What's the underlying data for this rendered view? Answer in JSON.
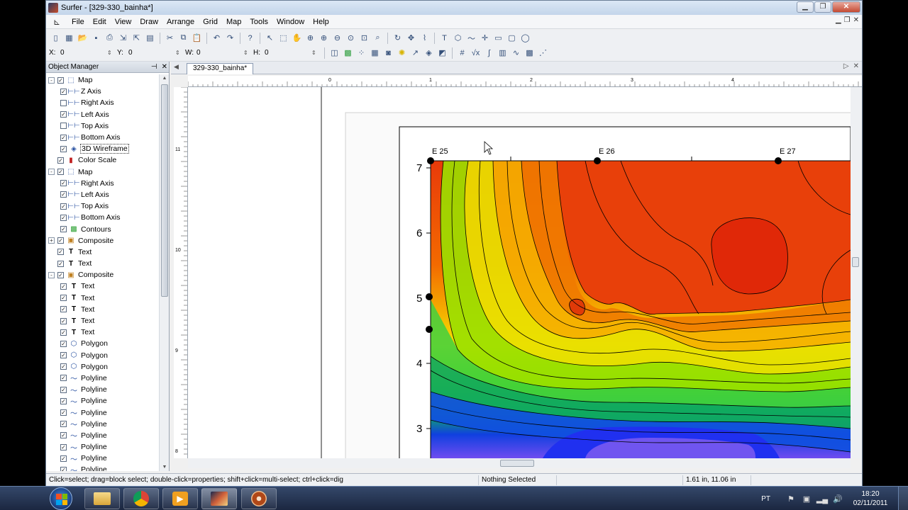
{
  "window": {
    "title": "Surfer - [329-330_bainha*]"
  },
  "menu": [
    "File",
    "Edit",
    "View",
    "Draw",
    "Arrange",
    "Grid",
    "Map",
    "Tools",
    "Window",
    "Help"
  ],
  "toolbar2": {
    "x_label": "X:",
    "x_value": "0",
    "y_label": "Y:",
    "y_value": "0",
    "w_label": "W:",
    "w_value": "0",
    "h_label": "H:",
    "h_value": "0"
  },
  "object_manager": {
    "title": "Object Manager",
    "items": [
      {
        "label": "Map",
        "indent": 0,
        "checked": true,
        "expander": "-",
        "icon": "map-frame-icon",
        "glyph": "⬚"
      },
      {
        "label": "Z Axis",
        "indent": 1,
        "checked": true,
        "icon": "axis-icon",
        "glyph": "⊢⊢"
      },
      {
        "label": "Right Axis",
        "indent": 1,
        "checked": false,
        "icon": "axis-icon",
        "glyph": "⊢⊢"
      },
      {
        "label": "Left Axis",
        "indent": 1,
        "checked": true,
        "icon": "axis-icon",
        "glyph": "⊢⊢"
      },
      {
        "label": "Top Axis",
        "indent": 1,
        "checked": false,
        "icon": "axis-icon",
        "glyph": "⊢⊢"
      },
      {
        "label": "Bottom Axis",
        "indent": 1,
        "checked": true,
        "icon": "axis-icon",
        "glyph": "⊢⊢"
      },
      {
        "label": "3D Wireframe",
        "indent": 1,
        "checked": true,
        "icon": "wireframe-icon",
        "glyph": "◈",
        "selected": true
      },
      {
        "label": "Color Scale",
        "indent": 0,
        "checked": true,
        "icon": "color-scale-icon",
        "glyph": "▮"
      },
      {
        "label": "Map",
        "indent": 0,
        "checked": true,
        "expander": "-",
        "icon": "map-frame-icon",
        "glyph": "⬚"
      },
      {
        "label": "Right Axis",
        "indent": 1,
        "checked": true,
        "icon": "axis-icon",
        "glyph": "⊢⊢"
      },
      {
        "label": "Left Axis",
        "indent": 1,
        "checked": true,
        "icon": "axis-icon",
        "glyph": "⊢⊢"
      },
      {
        "label": "Top Axis",
        "indent": 1,
        "checked": true,
        "icon": "axis-icon",
        "glyph": "⊢⊢"
      },
      {
        "label": "Bottom Axis",
        "indent": 1,
        "checked": true,
        "icon": "axis-icon",
        "glyph": "⊢⊢"
      },
      {
        "label": "Contours",
        "indent": 1,
        "checked": true,
        "icon": "contours-icon",
        "glyph": "▩"
      },
      {
        "label": "Composite",
        "indent": 0,
        "checked": true,
        "expander": "+",
        "icon": "composite-icon",
        "glyph": "▣"
      },
      {
        "label": "Text",
        "indent": 0,
        "checked": true,
        "icon": "text-icon",
        "glyph": "T"
      },
      {
        "label": "Text",
        "indent": 0,
        "checked": true,
        "icon": "text-icon",
        "glyph": "T"
      },
      {
        "label": "Composite",
        "indent": 0,
        "checked": true,
        "expander": "-",
        "icon": "composite-icon",
        "glyph": "▣"
      },
      {
        "label": "Text",
        "indent": 1,
        "checked": true,
        "icon": "text-icon",
        "glyph": "T"
      },
      {
        "label": "Text",
        "indent": 1,
        "checked": true,
        "icon": "text-icon",
        "glyph": "T"
      },
      {
        "label": "Text",
        "indent": 1,
        "checked": true,
        "icon": "text-icon",
        "glyph": "T"
      },
      {
        "label": "Text",
        "indent": 1,
        "checked": true,
        "icon": "text-icon",
        "glyph": "T"
      },
      {
        "label": "Text",
        "indent": 1,
        "checked": true,
        "icon": "text-icon",
        "glyph": "T"
      },
      {
        "label": "Polygon",
        "indent": 1,
        "checked": true,
        "icon": "polygon-icon",
        "glyph": "⬡"
      },
      {
        "label": "Polygon",
        "indent": 1,
        "checked": true,
        "icon": "polygon-icon",
        "glyph": "⬡"
      },
      {
        "label": "Polygon",
        "indent": 1,
        "checked": true,
        "icon": "polygon-icon",
        "glyph": "⬡"
      },
      {
        "label": "Polyline",
        "indent": 1,
        "checked": true,
        "icon": "polyline-icon",
        "glyph": "〜"
      },
      {
        "label": "Polyline",
        "indent": 1,
        "checked": true,
        "icon": "polyline-icon",
        "glyph": "〜"
      },
      {
        "label": "Polyline",
        "indent": 1,
        "checked": true,
        "icon": "polyline-icon",
        "glyph": "〜"
      },
      {
        "label": "Polyline",
        "indent": 1,
        "checked": true,
        "icon": "polyline-icon",
        "glyph": "〜"
      },
      {
        "label": "Polyline",
        "indent": 1,
        "checked": true,
        "icon": "polyline-icon",
        "glyph": "〜"
      },
      {
        "label": "Polyline",
        "indent": 1,
        "checked": true,
        "icon": "polyline-icon",
        "glyph": "〜"
      },
      {
        "label": "Polyline",
        "indent": 1,
        "checked": true,
        "icon": "polyline-icon",
        "glyph": "〜"
      },
      {
        "label": "Polyline",
        "indent": 1,
        "checked": true,
        "icon": "polyline-icon",
        "glyph": "〜"
      },
      {
        "label": "Polyline",
        "indent": 1,
        "checked": true,
        "icon": "polyline-icon",
        "glyph": "〜"
      }
    ]
  },
  "document": {
    "tab": "329-330_bainha*",
    "ruler_h_labels": [
      "0",
      "1",
      "2",
      "3",
      "4"
    ],
    "ruler_v_labels": [
      "11",
      "10",
      "9",
      "8"
    ],
    "map": {
      "top_labels": [
        "E 25",
        "E 26",
        "E 27"
      ],
      "left_labels": [
        "7",
        "6",
        "5",
        "4",
        "3"
      ]
    }
  },
  "status": {
    "hint": "Click=select; drag=block select; double-click=properties; shift+click=multi-select; ctrl+click=dig",
    "selection": "Nothing Selected",
    "coords": "1.61 in, 11.06 in"
  },
  "taskbar": {
    "lang": "PT",
    "time": "18:20",
    "date": "02/11/2011"
  }
}
